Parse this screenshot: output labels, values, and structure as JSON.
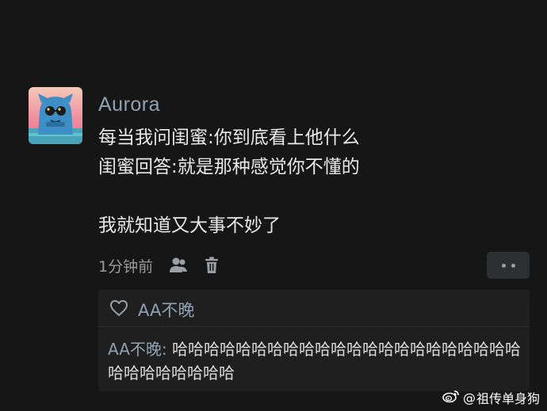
{
  "post": {
    "username": "Aurora",
    "lines": [
      "每当我问闺蜜:你到底看上他什么",
      "闺蜜回答:就是那种感觉你不懂的",
      "",
      "我就知道又大事不妙了"
    ],
    "time": "1分钟前"
  },
  "likes": {
    "liker": "AA不晚"
  },
  "reply": {
    "author": "AA不晚:",
    "text": " 哈哈哈哈哈哈哈哈哈哈哈哈哈哈哈哈哈哈哈哈哈哈哈哈哈哈哈哈哈哈"
  },
  "watermark": {
    "at": "@",
    "name": "祖传单身狗"
  },
  "icons": {
    "user": "user-icon",
    "delete": "trash-icon",
    "more": "more-dots-icon",
    "like": "heart-icon",
    "weibo": "weibo-logo-icon"
  },
  "colors": {
    "background": "#161616",
    "username": "#8fa2b4",
    "text": "#e9e9e9",
    "panel": "#1f1f20"
  }
}
